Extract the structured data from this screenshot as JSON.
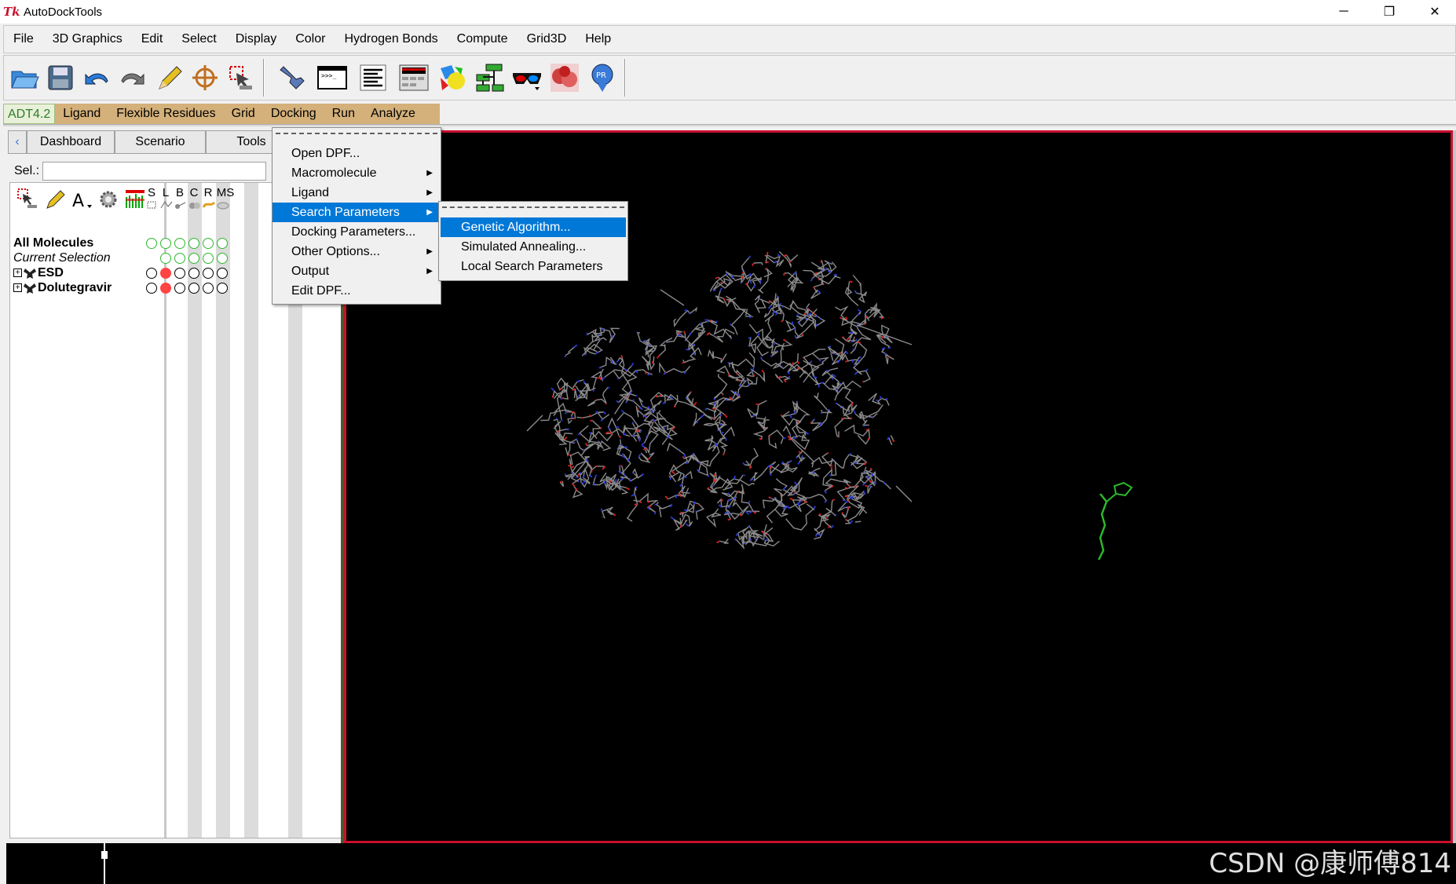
{
  "window": {
    "title": "AutoDockTools",
    "icon": "Tk",
    "controls": {
      "minimize": "─",
      "maximize": "❐",
      "close": "✕"
    }
  },
  "menubar": [
    "File",
    "3D Graphics",
    "Edit",
    "Select",
    "Display",
    "Color",
    "Hydrogen Bonds",
    "Compute",
    "Grid3D",
    "Help"
  ],
  "adt_menu": [
    "ADT4.2",
    "Ligand",
    "Flexible Residues",
    "Grid",
    "Docking",
    "Run",
    "Analyze"
  ],
  "tabs": [
    "Dashboard",
    "Scenario",
    "Tools"
  ],
  "selection": {
    "label": "Sel.:",
    "value": ""
  },
  "dashboard": {
    "columns": [
      "S",
      "L",
      "B",
      "C",
      "R",
      "MS"
    ],
    "rows": [
      {
        "label": "All Molecules",
        "style": "bold"
      },
      {
        "label": "Current Selection",
        "style": "italic"
      },
      {
        "label": "ESD",
        "style": "bold",
        "expandable": true
      },
      {
        "label": "Dolutegravir",
        "style": "bold",
        "expandable": true
      }
    ]
  },
  "docking_menu": {
    "items": [
      {
        "label": "Open DPF...",
        "submenu": false
      },
      {
        "label": "Macromolecule",
        "submenu": true
      },
      {
        "label": "Ligand",
        "submenu": true
      },
      {
        "label": "Search Parameters",
        "submenu": true,
        "active": true
      },
      {
        "label": "Docking Parameters...",
        "submenu": false
      },
      {
        "label": "Other Options...",
        "submenu": true
      },
      {
        "label": "Output",
        "submenu": true
      },
      {
        "label": "Edit DPF...",
        "submenu": false
      }
    ]
  },
  "search_submenu": {
    "items": [
      {
        "label": "Genetic Algorithm...",
        "active": true
      },
      {
        "label": "Simulated Annealing...",
        "active": false
      },
      {
        "label": "Local Search Parameters",
        "active": false
      }
    ]
  },
  "watermark": "CSDN @康师傅814",
  "colors": {
    "accent_highlight": "#0078d7",
    "adt_bar": "#d4b07a",
    "viewer_border": "#c8102e",
    "viewer_bg": "#000000"
  }
}
